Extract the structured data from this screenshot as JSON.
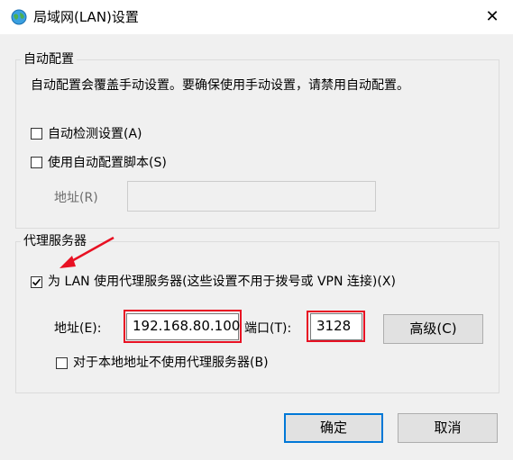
{
  "window": {
    "title": "局域网(LAN)设置",
    "close_glyph": "✕"
  },
  "auto_config": {
    "legend": "自动配置",
    "description": "自动配置会覆盖手动设置。要确保使用手动设置，请禁用自动配置。",
    "auto_detect_label": "自动检测设置(A)",
    "auto_detect_checked": false,
    "use_script_label": "使用自动配置脚本(S)",
    "use_script_checked": false,
    "address_label": "地址(R)",
    "address_value": ""
  },
  "proxy": {
    "legend": "代理服务器",
    "use_proxy_label": "为 LAN 使用代理服务器(这些设置不用于拨号或 VPN 连接)(X)",
    "use_proxy_checked": true,
    "address_label": "地址(E):",
    "address_value": "192.168.80.100",
    "port_label": "端口(T):",
    "port_value": "3128",
    "advanced_label": "高级(C)",
    "bypass_local_label": "对于本地地址不使用代理服务器(B)",
    "bypass_local_checked": false
  },
  "footer": {
    "ok_label": "确定",
    "cancel_label": "取消"
  },
  "colors": {
    "annotation_red": "#e81123",
    "default_button_border": "#0078d7"
  }
}
